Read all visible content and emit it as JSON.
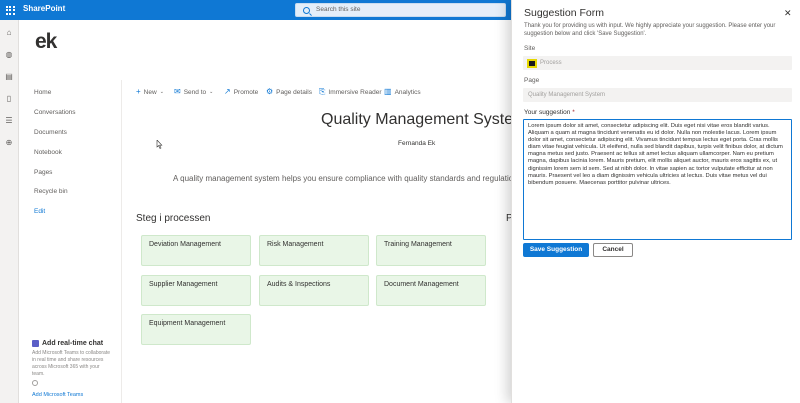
{
  "suitebar": {
    "brand": "SharePoint",
    "search_placeholder": "Search this site"
  },
  "site": {
    "logo_text": "ek"
  },
  "leftnav": {
    "items": [
      {
        "label": "Home"
      },
      {
        "label": "Conversations"
      },
      {
        "label": "Documents"
      },
      {
        "label": "Notebook"
      },
      {
        "label": "Pages"
      },
      {
        "label": "Recycle bin"
      },
      {
        "label": "Edit"
      }
    ],
    "promo": {
      "title": "Add real-time chat",
      "description": "Add Microsoft Teams to collaborate in real time and share resources across Microsoft 365 with your team.",
      "link": "Add Microsoft Teams"
    }
  },
  "commandbar": {
    "new": "New",
    "send_to": "Send to",
    "promote": "Promote",
    "page_details": "Page details",
    "immersive_reader": "Immersive Reader",
    "analytics": "Analytics"
  },
  "page": {
    "title": "Quality Management System",
    "author": "Fernanda Ek",
    "intro": "A quality management system helps you ensure compliance with quality standards and regulations",
    "section_title": "Steg i processen",
    "section_title_right": "P",
    "tiles": [
      {
        "label": "Deviation Management"
      },
      {
        "label": "Risk Management"
      },
      {
        "label": "Training Management"
      },
      {
        "label": "Supplier Management"
      },
      {
        "label": "Audits & Inspections"
      },
      {
        "label": "Document Management"
      },
      {
        "label": "Equipment Management"
      }
    ]
  },
  "panel": {
    "title": "Suggestion Form",
    "description": "Thank you for providing us with input. We highly appreciate your suggestion. Please enter your suggestion below and click 'Save Suggestion'.",
    "site_label": "Site",
    "site_value": "Process",
    "page_label": "Page",
    "page_value": "Quality Management System",
    "suggestion_label": "Your suggestion",
    "required_mark": "*",
    "suggestion_value": "Lorem ipsum dolor sit amet, consectetur adipiscing elit. Duis eget nisi vitae eros blandit varius. Aliquam a quam at magna tincidunt venenatis eu id dolor. Nulla non molestie lacus. Lorem ipsum dolor sit amet, consectetur adipiscing elit. Vivamus tincidunt tempus lectus eget porta. Cras mollis diam vitae feugiat vehicula. Ut eleifend, nulla sed blandit dapibus, turpis velit finibus dolor, at dictum magna metus sed justo. Praesent ac tellus sit amet lectus aliquam ullamcorper. Nam eu pretium magna, dapibus lacinia lorem. Mauris pretium, elit mollis aliquet auctor, mauris eros sagittis ex, ut dignissim lorem sem id sem. Sed at nibh dolor. In vitae sapien ac tortor vulputate efficitur at non mauris. Praesent vel leo a diam dignissim vehicula ultricies at lectus. Duis vitae metus vel dui bibendum posuere. Maecenas porttitor pulvinar ultrices.",
    "save_label": "Save Suggestion",
    "cancel_label": "Cancel",
    "close_glyph": "✕"
  }
}
